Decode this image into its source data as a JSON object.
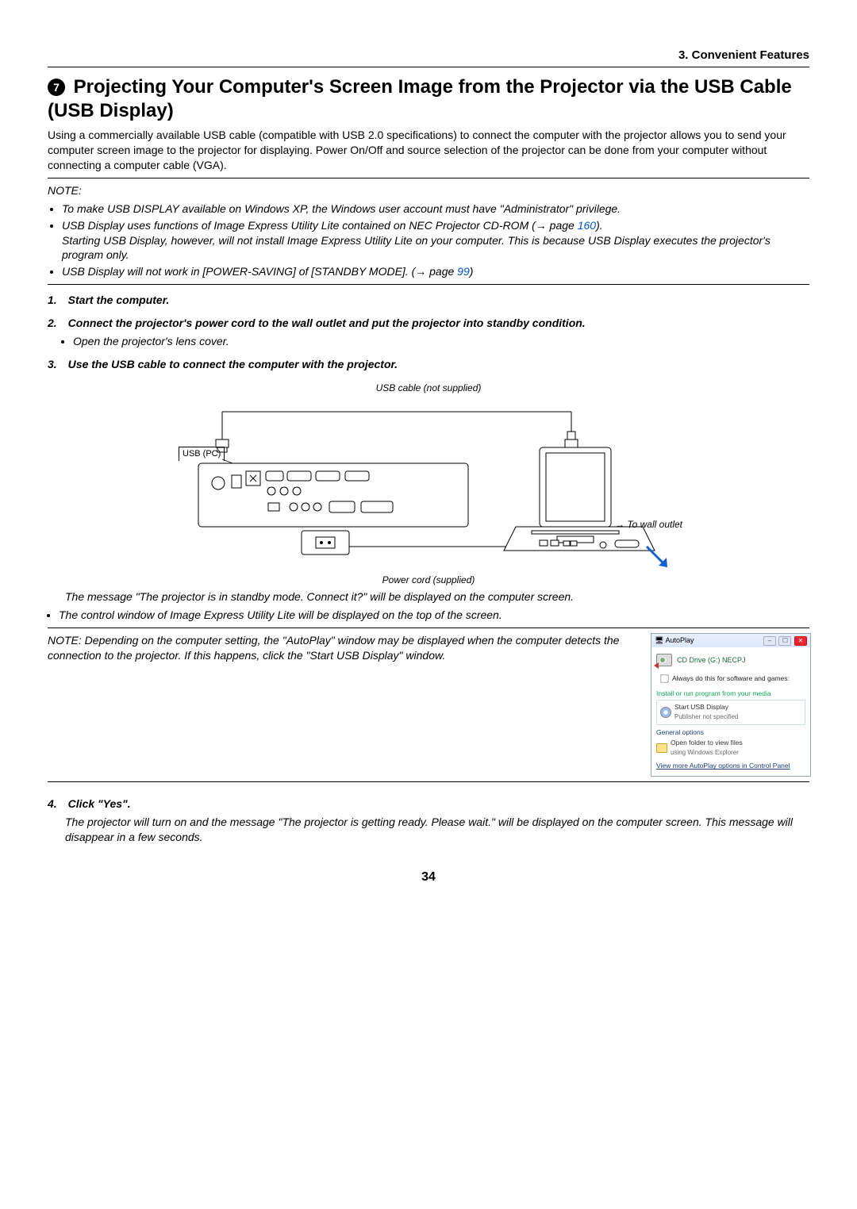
{
  "header": {
    "chapter": "3. Convenient Features"
  },
  "title": {
    "bullet_num": "7",
    "text": "Projecting Your Computer's Screen Image from the Projector via the USB Cable (USB Display)"
  },
  "intro": "Using a commercially available USB cable (compatible with USB 2.0 specifications) to connect the computer with the projector allows you to send your computer screen image to the projector for displaying. Power On/Off and source selection of the projector can be done from your computer without connecting a computer cable (VGA).",
  "note_label": "NOTE:",
  "notes": {
    "n1": "To make USB DISPLAY available on Windows XP, the Windows user account must have \"Administrator\" privilege.",
    "n2a": "USB Display uses functions of Image Express Utility Lite contained on NEC Projector CD-ROM (→ page ",
    "n2_page": "160",
    "n2b": ").",
    "n2c": "Starting USB Display, however, will not install Image Express Utility Lite on your computer. This is because USB Display executes the projector's program only.",
    "n3a": "USB Display will not work in [POWER-SAVING] of [STANDBY MODE]. (→ page ",
    "n3_page": "99",
    "n3b": ")"
  },
  "steps": {
    "s1": "1. Start the computer.",
    "s2": "2. Connect the projector's power cord to the wall outlet and put the projector into standby condition.",
    "s2_sub": "Open the projector's lens cover.",
    "s3": "3. Use the USB cable to connect the computer with the projector.",
    "s4": "4. Click \"Yes\"."
  },
  "diagram": {
    "usb_cable": "USB cable (not supplied)",
    "usb_pc": "USB (PC)",
    "to_wall": "→ To wall outlet",
    "power_cord": "Power cord (supplied)"
  },
  "after_diagram": {
    "msg1": "The message \"The projector is in standby mode. Connect it?\" will be displayed on the computer screen.",
    "msg2": "The control window of Image Express Utility Lite will be displayed on the top of the screen."
  },
  "note2": "NOTE: Depending on the computer setting, the \"AutoPlay\" window may be displayed when the computer detects the connection to the projector. If this happens, click the \"Start USB Display\" window.",
  "autoplay": {
    "title": "AutoPlay",
    "drive": "CD Drive (G:) NECPJ",
    "check": "Always do this for software and games:",
    "group1": "Install or run program from your media",
    "opt1": "Start USB Display",
    "opt1_sub": "Publisher not specified",
    "group2": "General options",
    "opt2": "Open folder to view files",
    "opt2_sub": "using Windows Explorer",
    "more": "View more AutoPlay options in Control Panel"
  },
  "step4_body": "The projector will turn on and the message \"The projector is getting ready. Please wait.\" will be displayed on the computer screen. This message will disappear in a few seconds.",
  "page_number": "34"
}
